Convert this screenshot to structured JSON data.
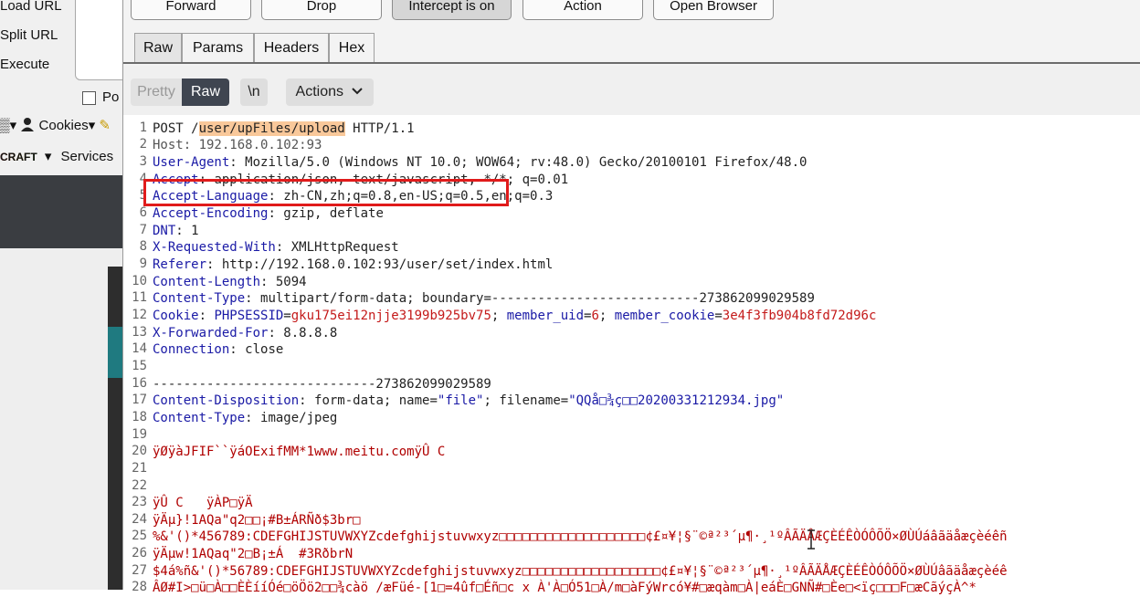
{
  "left_panel": {
    "load_url": "Load URL",
    "split_url": "Split URL",
    "execute": "Execute",
    "post_label": "Po",
    "toolbar_prefix": "▒▾",
    "cookies": "Cookies▾",
    "craft": "CRAFT",
    "services_prefix": "▾",
    "services": "Services"
  },
  "burp": {
    "buttons": {
      "forward": "Forward",
      "drop": "Drop",
      "intercept": "Intercept is on",
      "action": "Action",
      "open_browser": "Open Browser"
    },
    "tabs": [
      "Raw",
      "Params",
      "Headers",
      "Hex"
    ],
    "toolbar": {
      "pretty": "Pretty",
      "raw": "Raw",
      "newline": "\\n",
      "actions": "Actions"
    },
    "request": {
      "line1": {
        "method": "POST /",
        "path": "user/upFiles/upload",
        "rest": " HTTP/1.1"
      },
      "line2": "Host: 192.168.0.102:93",
      "headers": [
        {
          "n": "3",
          "k": "User-Agent",
          "v": " Mozilla/5.0 (Windows NT 10.0; WOW64; rv:48.0) Gecko/20100101 Firefox/48.0"
        },
        {
          "n": "4",
          "k": "Accept",
          "v": " application/json, text/javascript, */*; q=0.01"
        },
        {
          "n": "5",
          "k": "Accept-Language",
          "v": " zh-CN,zh;q=0.8,en-US;q=0.5,en;q=0.3"
        },
        {
          "n": "6",
          "k": "Accept-Encoding",
          "v": " gzip, deflate"
        },
        {
          "n": "7",
          "k": "DNT",
          "v": " 1"
        },
        {
          "n": "8",
          "k": "X-Requested-With",
          "v": " XMLHttpRequest"
        },
        {
          "n": "9",
          "k": "Referer",
          "v": " http://192.168.0.102:93/user/set/index.html"
        },
        {
          "n": "10",
          "k": "Content-Length",
          "v": " 5094"
        },
        {
          "n": "11",
          "k": "Content-Type",
          "v": " multipart/form-data; boundary=---------------------------273862099029589"
        }
      ],
      "cookie": {
        "k": "Cookie",
        "pairs": [
          {
            "name": "PHPSESSID",
            "val": "gku175ei12njje3199b925bv75"
          },
          {
            "name": "member_uid",
            "val": "6"
          },
          {
            "name": "member_cookie",
            "val": "3e4f3fb904b8fd72d96c"
          }
        ]
      },
      "xff": {
        "n": "13",
        "k": "X-Forwarded-For",
        "v": " 8.8.8.8"
      },
      "conn": {
        "n": "14",
        "k": "Connection",
        "v": " close"
      },
      "boundary": "-----------------------------273862099029589",
      "disposition": {
        "k": "Content-Disposition",
        "v1": " form-data; name=",
        "name": "\"file\"",
        "v2": "; filename=",
        "filename": "\"QQå□¾ç□□20200331212934.jpg\""
      },
      "ctype2": {
        "k": "Content-Type",
        "v": " image/jpeg"
      },
      "binary": [
        {
          "n": "20",
          "t": "ÿØÿàJFIF``ÿáOExifMM*1www.meitu.comÿÛ C"
        },
        {
          "n": "23",
          "t": "ÿÛ C   ÿÀP□ÿÄ"
        },
        {
          "n": "24",
          "t": "ÿÄµ}!1AQa\"q2□□¡#B±ÁRÑð$3br□"
        },
        {
          "n": "25",
          "t": "%&'()*456789:CDEFGHIJSTUVWXYZcdefghijstuvwxyz□□□□□□□□□□□□□□□□□□□¢£¤¥¦§¨©ª²³´µ¶·¸¹ºÂÃÄÅÆÇÈÉÊÒÓÔÕÖ×ØÙÚáâãäåæçèéêñ"
        },
        {
          "n": "26",
          "t": "ÿÄµw!1AQaq\"2□B¡±Á  #3RðbrN"
        },
        {
          "n": "27",
          "t": "$4á%ñ&'()*56789:CDEFGHIJSTUVWXYZcdefghijstuvwxyz□□□□□□□□□□□□□□□□□□¢£¤¥¦§¨©ª²³´µ¶·¸¹ºÂÃÄÅÆÇÈÉÊÒÓÔÕÖ×ØÙÚâãäåæçèéê"
        },
        {
          "n": "28",
          "t": "ÂØ#I>□ü□À□□ÈÈííÓé□öÖö2□□¾càö /æFüé-[1□=4ûf□Éñ□c x À'À□Ó51□À/m□àFýWrcó¥#□æqàm□À|eáÈ□GNÑ#□Èe□<ïç□□□F□æCãýçÀ^*"
        }
      ]
    }
  }
}
